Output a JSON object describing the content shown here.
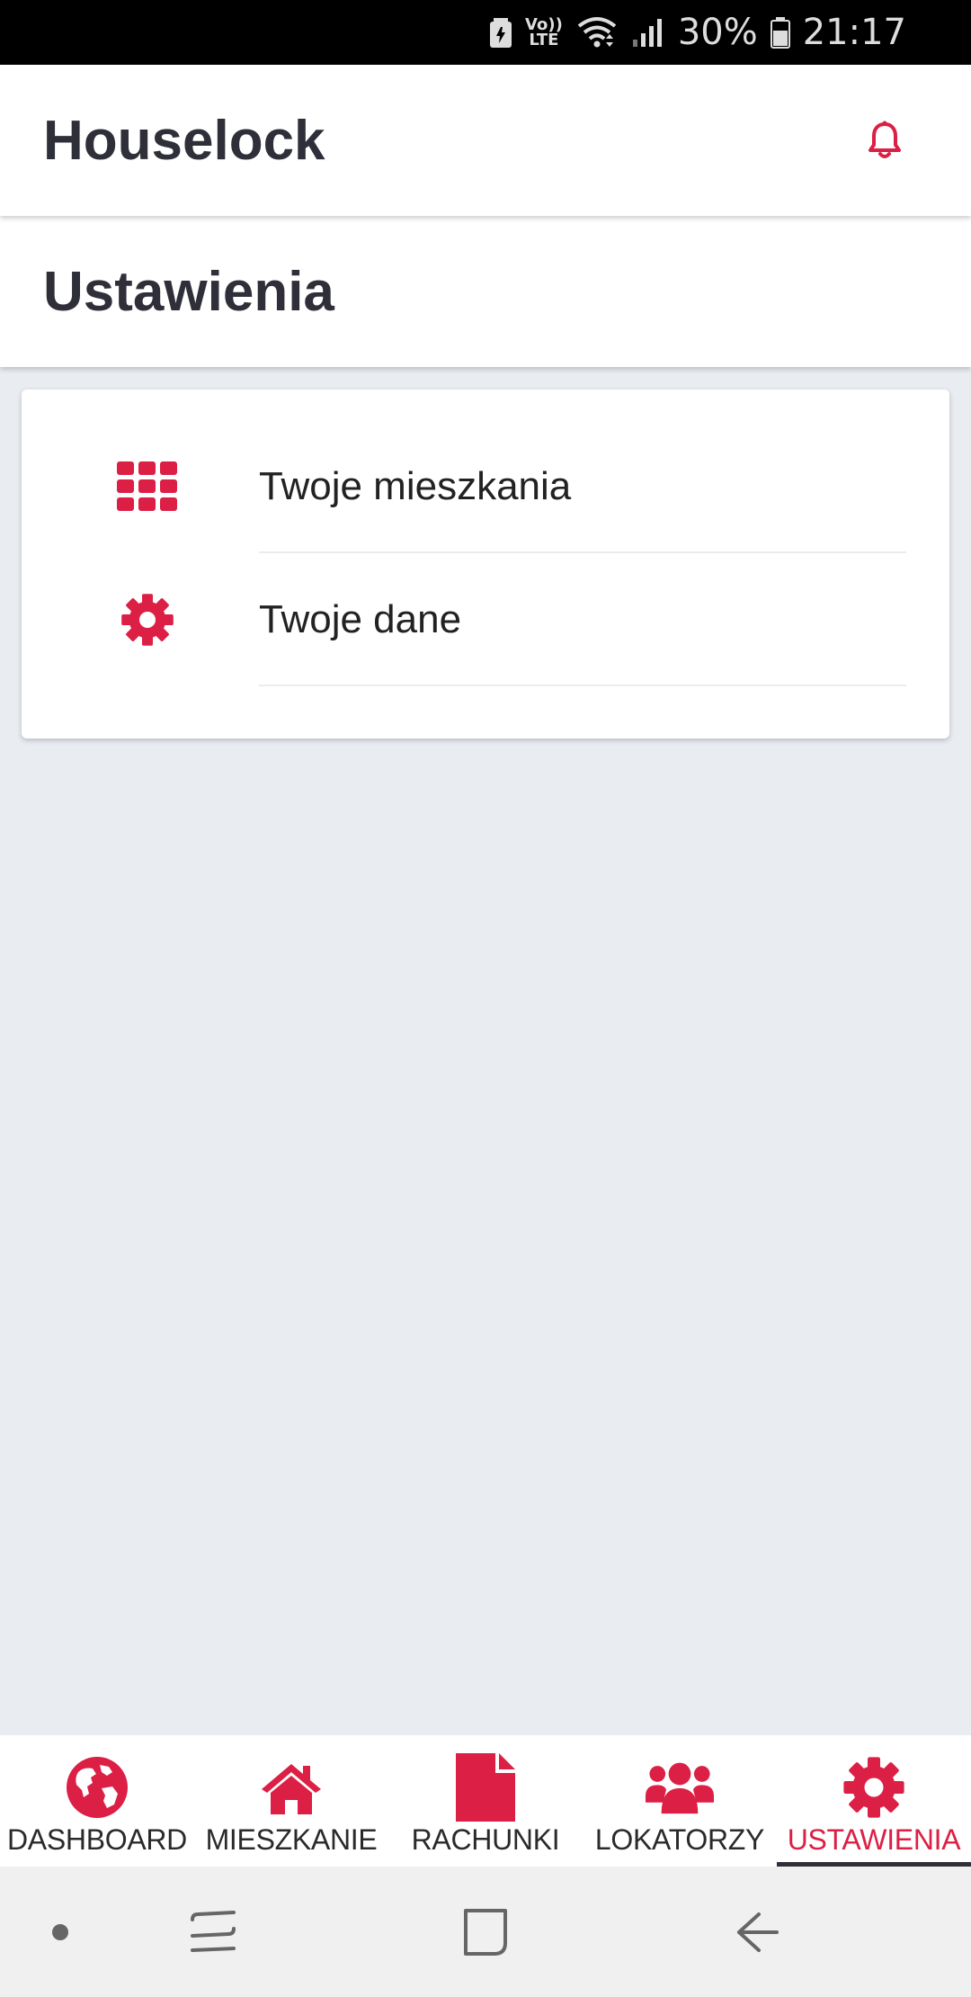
{
  "status_bar": {
    "volte_top": "Vo))",
    "volte_bottom": "LTE",
    "battery_percent": "30%",
    "time": "21:17"
  },
  "header": {
    "title": "Houselock",
    "bell_icon": "bell-icon"
  },
  "page": {
    "title": "Ustawienia"
  },
  "settings_menu": {
    "items": [
      {
        "label": "Twoje mieszkania",
        "icon": "grid-icon"
      },
      {
        "label": "Twoje dane",
        "icon": "gear-icon"
      }
    ]
  },
  "bottom_nav": {
    "items": [
      {
        "label": "DASHBOARD",
        "icon": "globe-icon",
        "active": false
      },
      {
        "label": "MIESZKANIE",
        "icon": "home-icon",
        "active": false
      },
      {
        "label": "RACHUNKI",
        "icon": "file-icon",
        "active": false
      },
      {
        "label": "LOKATORZY",
        "icon": "users-icon",
        "active": false
      },
      {
        "label": "USTAWIENIA",
        "icon": "gear-icon",
        "active": true
      }
    ]
  },
  "colors": {
    "accent": "#dc1f44",
    "text_dark": "#2f2f3a",
    "background": "#e9edf1"
  }
}
